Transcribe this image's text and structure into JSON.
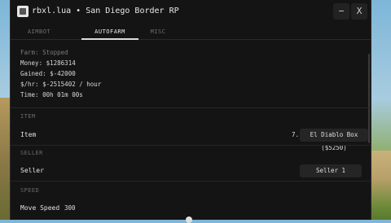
{
  "window": {
    "title": "rbxl.lua  •  San Diego Border RP",
    "minimize_glyph": "−",
    "close_glyph": "X"
  },
  "tabs": [
    {
      "label": "AIMBOT",
      "active": false
    },
    {
      "label": "AUTOFARM",
      "active": true
    },
    {
      "label": "MISC",
      "active": false
    }
  ],
  "status": {
    "farm": "Farm: Stopped",
    "money": "Money: $1286314",
    "gained": "Gained: $-42000",
    "rate": "$/hr: $-2515402 / hour",
    "time": "Time: 00h 01m 00s"
  },
  "item_section": {
    "header": "ITEM",
    "label": "Item",
    "index": "7.",
    "value": "El Diablo Box ($5250)"
  },
  "seller_section": {
    "header": "SELLER",
    "label": "Seller",
    "value": "Seller 1"
  },
  "speed_section": {
    "header": "SPEED",
    "label": "Move Speed",
    "value": "300"
  },
  "colors": {
    "panel": "#141414",
    "chip": "#252525",
    "text": "#d8d8d8",
    "muted": "#6f6f6f"
  }
}
